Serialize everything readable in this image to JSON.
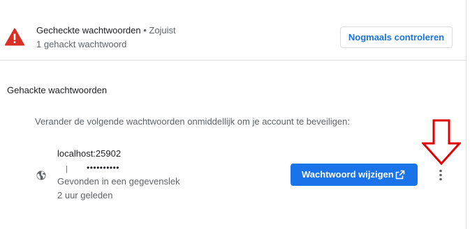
{
  "check": {
    "title": "Gecheckte wachtwoorden",
    "separator": " • ",
    "time": "Zojuist",
    "subtitle": "1 gehackt wachtwoord",
    "recheck_label": "Nogmaals controleren",
    "warning_icon": "warning-triangle-icon",
    "warning_color": "#d93025"
  },
  "compromised": {
    "section_title": "Gehackte wachtwoorden",
    "instruction": "Verander de volgende wachtwoorden onmiddellijk om je account te beveiligen:",
    "items": [
      {
        "site": "localhost:25902",
        "username": "|",
        "password_mask": "••••••••••",
        "status": "Gevonden in een gegevenslek",
        "time_ago": "2 uur geleden",
        "change_label": "Wachtwoord wijzigen",
        "site_icon": "globe-icon",
        "change_icon": "external-link-icon",
        "more_icon": "more-vert-icon"
      }
    ]
  },
  "colors": {
    "accent": "#1a73e8",
    "annotation_arrow": "#e00000"
  }
}
